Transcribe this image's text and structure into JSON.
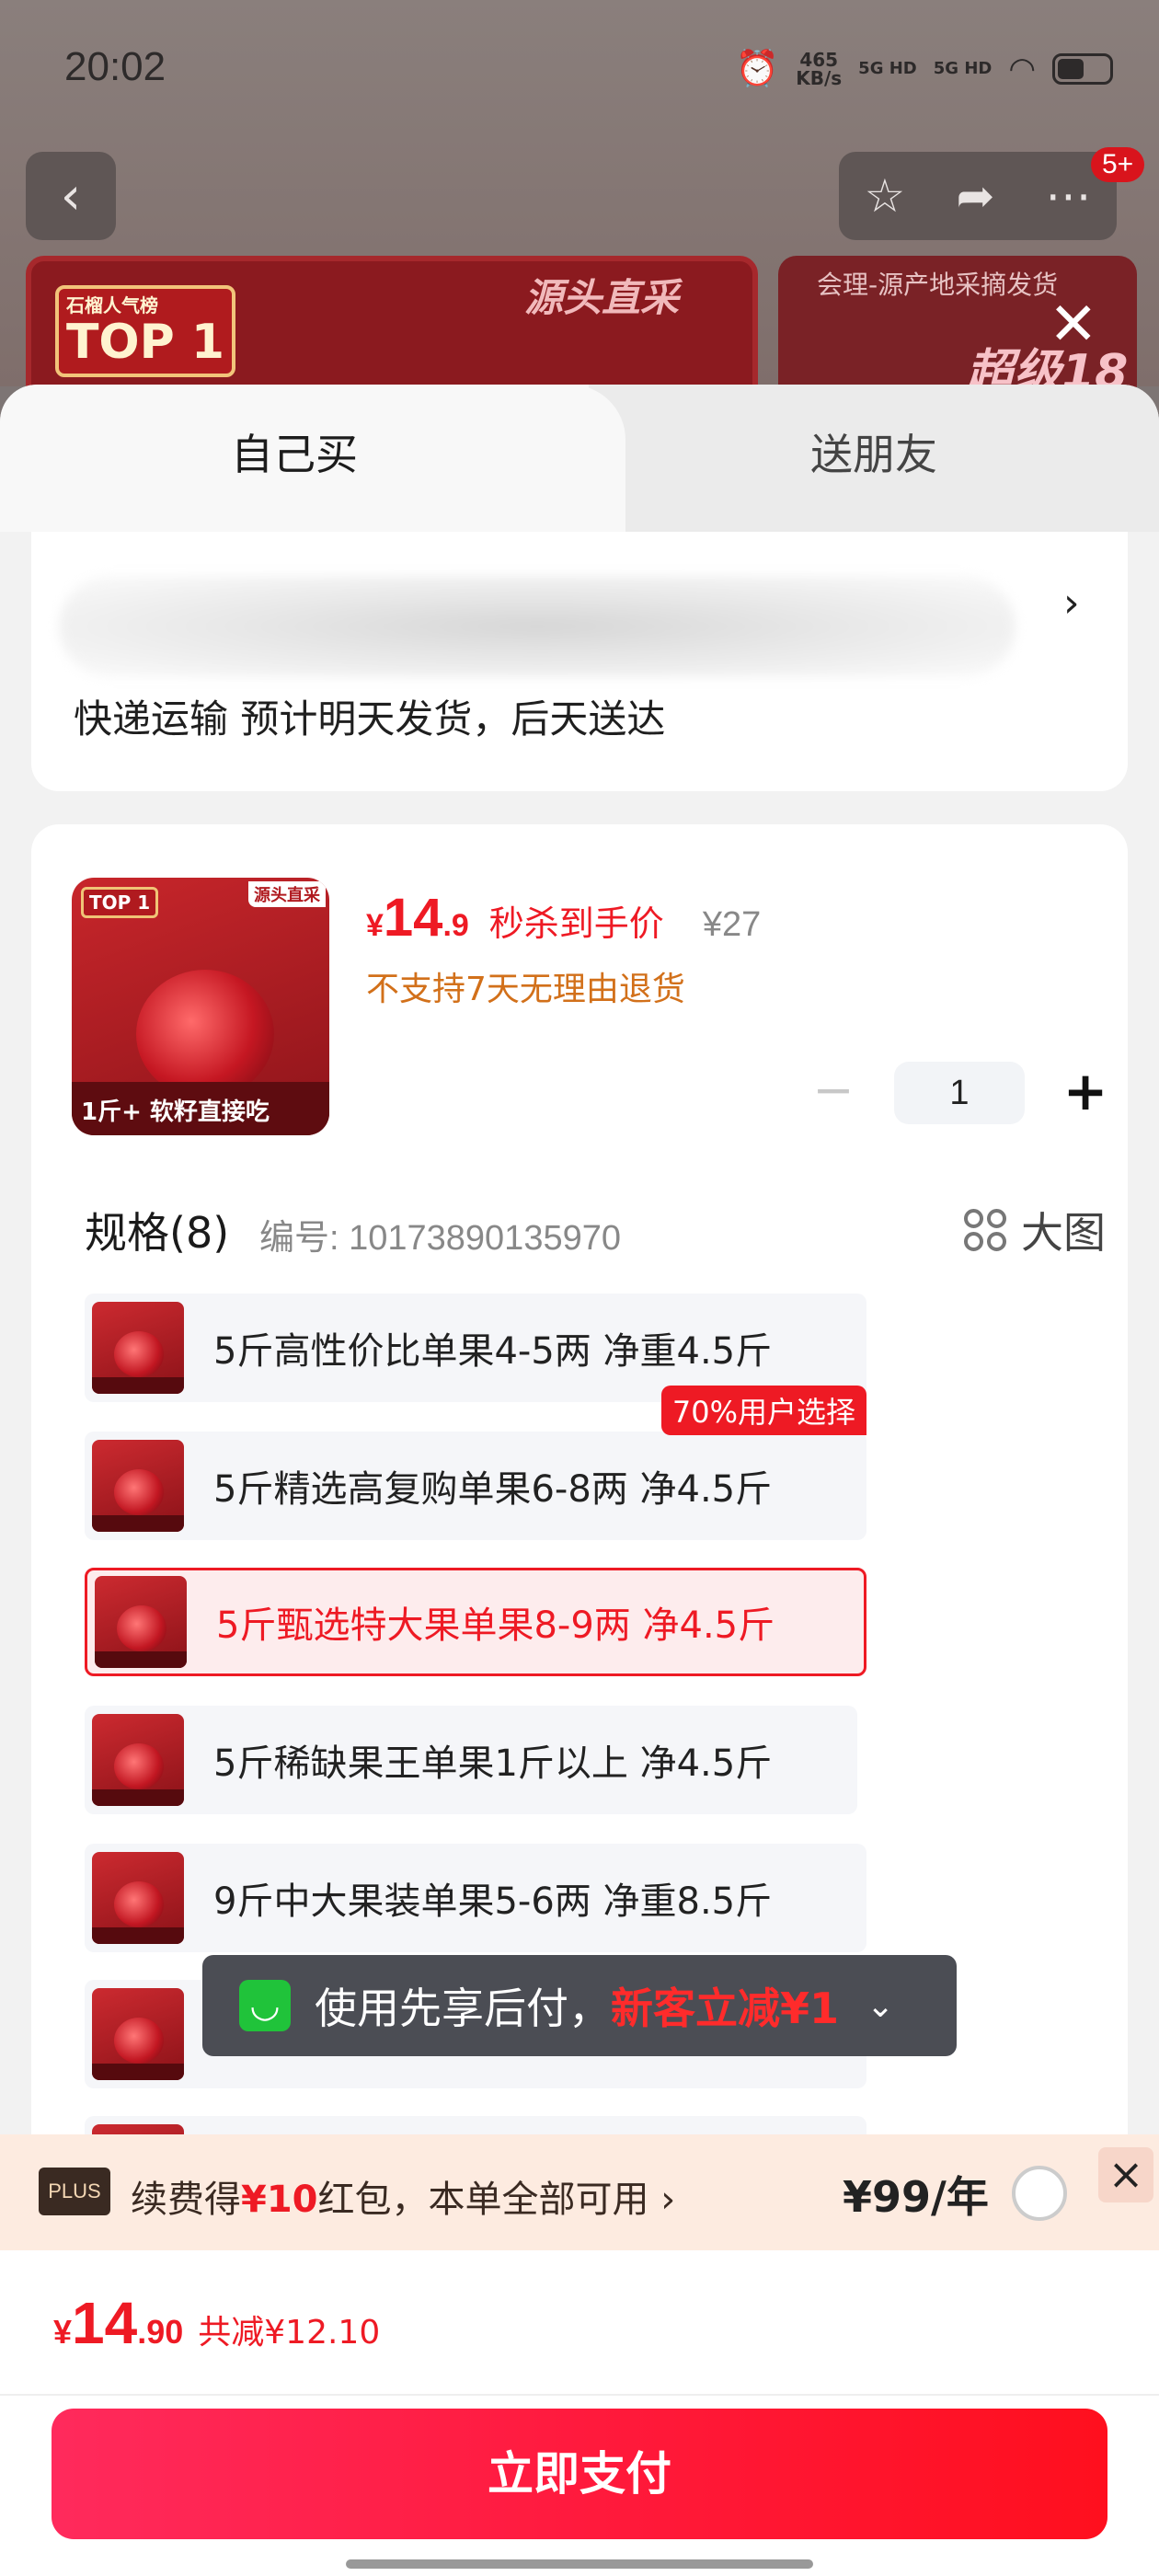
{
  "status_bar": {
    "time": "20:02",
    "net_speed": "465",
    "net_unit": "KB/s",
    "sig1": "5G HD",
    "sig2": "5G HD"
  },
  "background": {
    "badge": "5+",
    "banner_top": "TOP 1",
    "banner_top_small": "石榴人气榜",
    "banner_source": "源头直采",
    "banner2_text": "会理-源产地采摘发货",
    "banner_super": "超级18"
  },
  "tabs": {
    "self": "自己买",
    "friend": "送朋友"
  },
  "address": {
    "shipping": "快递运输 预计明天发货，后天送达",
    "chevron": "›"
  },
  "product": {
    "image_top": "TOP 1",
    "image_source": "源头直采",
    "image_band": "1斤+ 软籽直接吃",
    "price_symbol": "¥",
    "price_int": "14",
    "price_dec": ".9",
    "price_tag": "秒杀到手价",
    "orig_price": "¥27",
    "no_return": "不支持7天无理由退货",
    "quantity": "1",
    "minus": "−",
    "plus": "+"
  },
  "spec": {
    "title": "规格(8)",
    "code": "编号: 10173890135970",
    "big_pic": "大图",
    "items": [
      {
        "label": "5斤高性价比单果4-5两 净重4.5斤"
      },
      {
        "label": "5斤精选高复购单果6-8两 净4.5斤",
        "badge": "70%用户选择"
      },
      {
        "label": "5斤甄选特大果单果8-9两 净4.5斤"
      },
      {
        "label": "5斤稀缺果王单果1斤以上 净4.5斤"
      },
      {
        "label": "9斤中大果装单果5-6两 净重8.5斤"
      }
    ]
  },
  "toast": {
    "icon": "◡",
    "text": "使用先享后付，",
    "highlight": "新客立减¥1",
    "chevron": "⌄"
  },
  "plus": {
    "logo": "PLUS",
    "text_pre": "续费得",
    "text_red": "¥10",
    "text_post": "红包，本单全部可用 ›",
    "price": "¥99/年",
    "close": "×"
  },
  "footer": {
    "total_symbol": "¥",
    "total_int": "14",
    "total_dec": ".90",
    "saved": "共减¥12.10",
    "pay_label": "立即支付"
  },
  "colors": {
    "accent": "#ee1a24",
    "warning": "#d2701a",
    "toast_bg": "#4b4d54",
    "plus_bg": "#fdebe0"
  }
}
